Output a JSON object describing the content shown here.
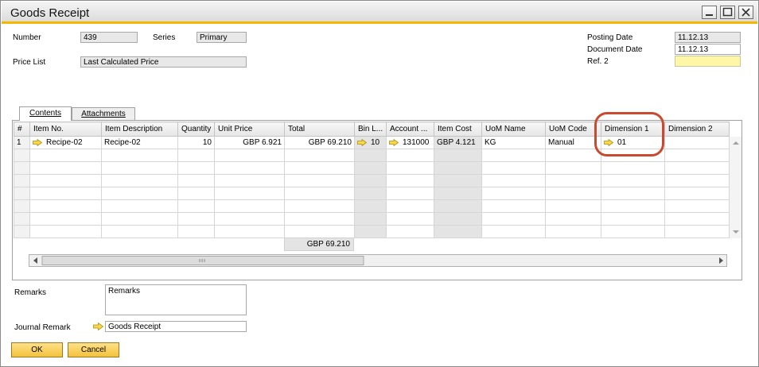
{
  "window": {
    "title": "Goods Receipt"
  },
  "header": {
    "number_label": "Number",
    "number_value": "439",
    "series_label": "Series",
    "series_value": "Primary",
    "price_list_label": "Price List",
    "price_list_value": "Last Calculated Price",
    "posting_date_label": "Posting Date",
    "posting_date_value": "11.12.13",
    "document_date_label": "Document Date",
    "document_date_value": "11.12.13",
    "ref2_label": "Ref. 2",
    "ref2_value": ""
  },
  "tabs": [
    {
      "label": "Contents"
    },
    {
      "label": "Attachments"
    }
  ],
  "grid": {
    "columns": [
      "#",
      "Item No.",
      "Item Description",
      "Quantity",
      "Unit Price",
      "Total",
      "Bin L...",
      "Account ...",
      "Item Cost",
      "UoM Name",
      "UoM Code",
      "Dimension 1",
      "Dimension 2"
    ],
    "row1": {
      "num": "1",
      "item_no": "Recipe-02",
      "item_desc": "Recipe-02",
      "quantity": "10",
      "unit_price": "GBP 6.921",
      "total": "GBP 69.210",
      "bin": "10",
      "account": "131000",
      "item_cost": "GBP 4.121",
      "uom_name": "KG",
      "uom_code": "Manual",
      "dimension1": "01",
      "dimension2": ""
    },
    "footer_total": "GBP 69.210"
  },
  "remarks": {
    "label": "Remarks",
    "value": "Remarks"
  },
  "journal": {
    "label": "Journal Remark",
    "value": "Goods Receipt"
  },
  "buttons": {
    "ok": "OK",
    "cancel": "Cancel"
  },
  "colors": {
    "accent": "#f5b800",
    "highlight": "#c94a2e",
    "button": "#f3c23c"
  }
}
